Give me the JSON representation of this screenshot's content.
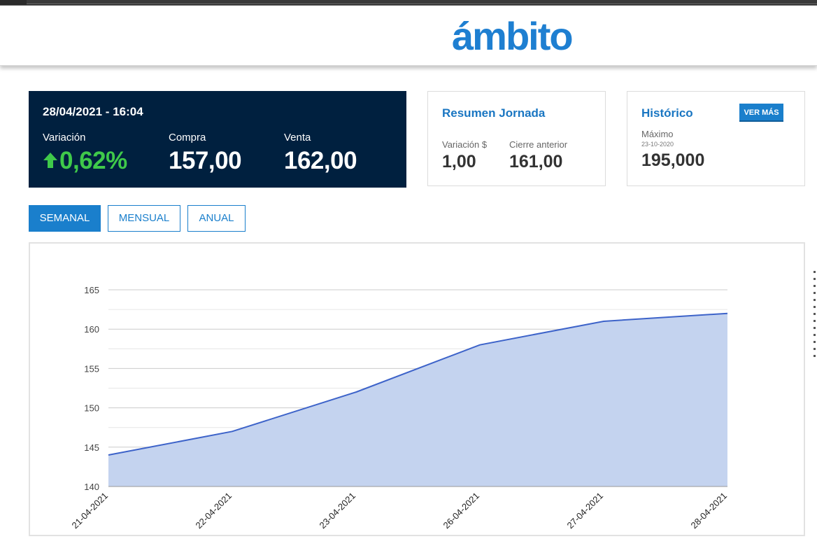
{
  "header": {
    "logo": "ámbito"
  },
  "quote": {
    "datetime": "28/04/2021 - 16:04",
    "variacion_label": "Variación",
    "variacion_value": "0,62%",
    "compra_label": "Compra",
    "compra_value": "157,00",
    "venta_label": "Venta",
    "venta_value": "162,00"
  },
  "resumen": {
    "title": "Resumen Jornada",
    "variacion_label": "Variación $",
    "variacion_value": "1,00",
    "cierre_label": "Cierre anterior",
    "cierre_value": "161,00"
  },
  "historico": {
    "title": "Histórico",
    "button": "VER MÁS",
    "max_label": "Máximo",
    "max_date": "23-10-2020",
    "max_value": "195,000"
  },
  "tabs": [
    {
      "label": "SEMANAL",
      "active": true
    },
    {
      "label": "MENSUAL",
      "active": false
    },
    {
      "label": "ANUAL",
      "active": false
    }
  ],
  "colors": {
    "navy": "#00203f",
    "accent": "#1a7fcc",
    "green": "#3fc94a",
    "line": "#3d63c9",
    "fill": "#c4d3ef"
  },
  "chart_data": {
    "type": "area",
    "x": [
      "21-04-2021",
      "22-04-2021",
      "23-04-2021",
      "26-04-2021",
      "27-04-2021",
      "28-04-2021"
    ],
    "series": [
      {
        "values": [
          144,
          147,
          152,
          158,
          161,
          162
        ]
      }
    ],
    "ylim": [
      140,
      165
    ],
    "yticks": [
      140,
      145,
      150,
      155,
      160,
      165
    ],
    "grid": true
  }
}
